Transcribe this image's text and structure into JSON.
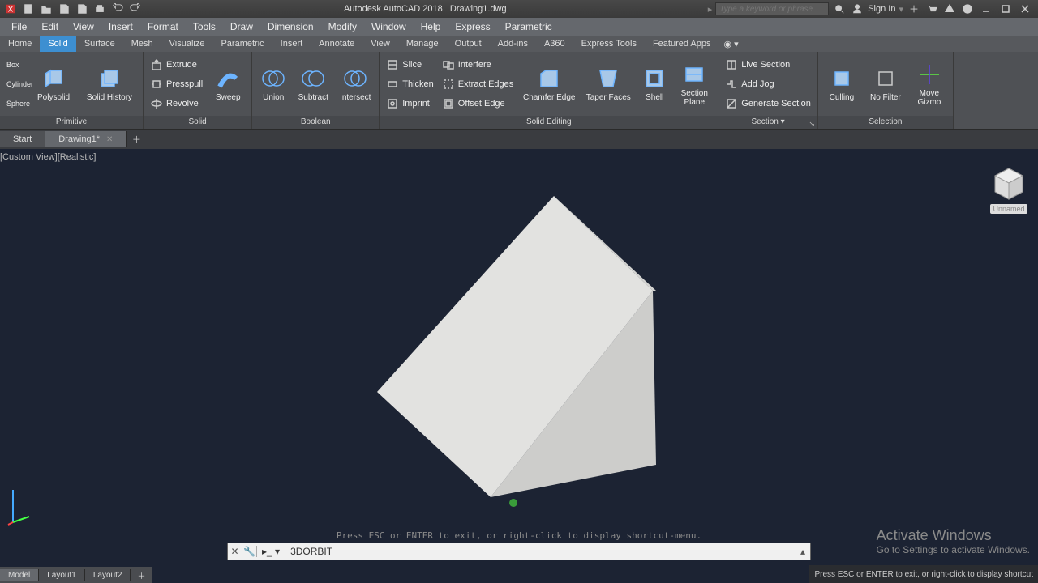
{
  "title": {
    "app": "Autodesk AutoCAD 2018",
    "file": "Drawing1.dwg"
  },
  "search": {
    "placeholder": "Type a keyword or phrase"
  },
  "signin": "Sign In",
  "menu": [
    "File",
    "Edit",
    "View",
    "Insert",
    "Format",
    "Tools",
    "Draw",
    "Dimension",
    "Modify",
    "Window",
    "Help",
    "Express",
    "Parametric"
  ],
  "ws_tabs": [
    "Home",
    "Solid",
    "Surface",
    "Mesh",
    "Visualize",
    "Parametric",
    "Insert",
    "Annotate",
    "View",
    "Manage",
    "Output",
    "Add-ins",
    "A360",
    "Express Tools",
    "Featured Apps"
  ],
  "ws_active_index": 1,
  "ribbon": {
    "primitive": {
      "title": "Primitive",
      "box": "Box",
      "cylinder": "Cylinder",
      "sphere": "Sphere",
      "polysolid": "Polysolid",
      "history": "Solid History"
    },
    "solid": {
      "title": "Solid",
      "sweep": "Sweep",
      "extrude": "Extrude",
      "presspull": "Presspull",
      "revolve": "Revolve"
    },
    "boolean": {
      "title": "Boolean",
      "union": "Union",
      "subtract": "Subtract",
      "intersect": "Intersect"
    },
    "editing": {
      "title": "Solid Editing",
      "slice": "Slice",
      "thicken": "Thicken",
      "imprint": "Imprint",
      "interfere": "Interfere",
      "extract": "Extract Edges",
      "offset": "Offset Edge",
      "chamfer": "Chamfer Edge",
      "taper": "Taper Faces",
      "shell": "Shell",
      "plane": "Section Plane"
    },
    "section": {
      "title": "Section",
      "live": "Live Section",
      "jog": "Add Jog",
      "generate": "Generate Section"
    },
    "selection": {
      "title": "Selection",
      "culling": "Culling",
      "nofilter": "No Filter",
      "gizmo": "Move Gizmo"
    }
  },
  "doc_tabs": {
    "start": "Start",
    "active": "Drawing1*"
  },
  "view_label": "[Custom View][Realistic]",
  "viewcube": {
    "label": "Unnamed"
  },
  "command": {
    "hint": "Press ESC or ENTER to exit, or right-click to display shortcut-menu.",
    "prompt": "▸",
    "text": "3DORBIT"
  },
  "layout_tabs": [
    "Model",
    "Layout1",
    "Layout2"
  ],
  "activate": {
    "title": "Activate Windows",
    "sub": "Go to Settings to activate Windows."
  },
  "status_hint": "Press ESC or ENTER to exit, or right-click to display shortcut"
}
